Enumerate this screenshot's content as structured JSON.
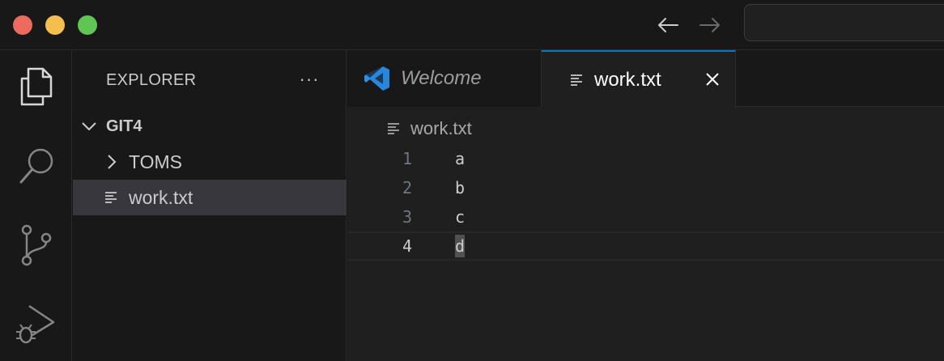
{
  "window": {
    "traffic_lights": {
      "close_color": "#ed6a5e",
      "minimize_color": "#f5bf4f",
      "maximize_color": "#61c554"
    },
    "nav": {
      "back_icon": "arrow-left-icon",
      "forward_icon": "arrow-right-icon"
    },
    "command_center": {
      "value": ""
    }
  },
  "activity_bar": {
    "items": [
      {
        "name": "explorer",
        "icon": "files-icon",
        "active": true
      },
      {
        "name": "search",
        "icon": "search-icon",
        "active": false
      },
      {
        "name": "source-control",
        "icon": "source-control-icon",
        "active": false
      },
      {
        "name": "run-and-debug",
        "icon": "run-debug-icon",
        "active": false
      }
    ]
  },
  "sidebar": {
    "title": "EXPLORER",
    "more_label": "···",
    "tree": {
      "root": {
        "label": "GIT4",
        "expanded": true
      },
      "items": [
        {
          "label": "TOMS",
          "type": "folder",
          "expanded": false
        },
        {
          "label": "work.txt",
          "type": "file",
          "selected": true
        }
      ]
    }
  },
  "editor": {
    "tabs": [
      {
        "label": "Welcome",
        "icon": "vscode-logo-icon",
        "active": false,
        "preview": true
      },
      {
        "label": "work.txt",
        "icon": "text-file-icon",
        "active": true
      }
    ],
    "breadcrumb": {
      "label": "work.txt",
      "icon": "text-file-icon"
    },
    "lines": [
      {
        "number": "1",
        "text": "a"
      },
      {
        "number": "2",
        "text": "b"
      },
      {
        "number": "3",
        "text": "c"
      },
      {
        "number": "4",
        "text": "d"
      }
    ],
    "current_line": 4,
    "accent_color": "#0078d4"
  }
}
